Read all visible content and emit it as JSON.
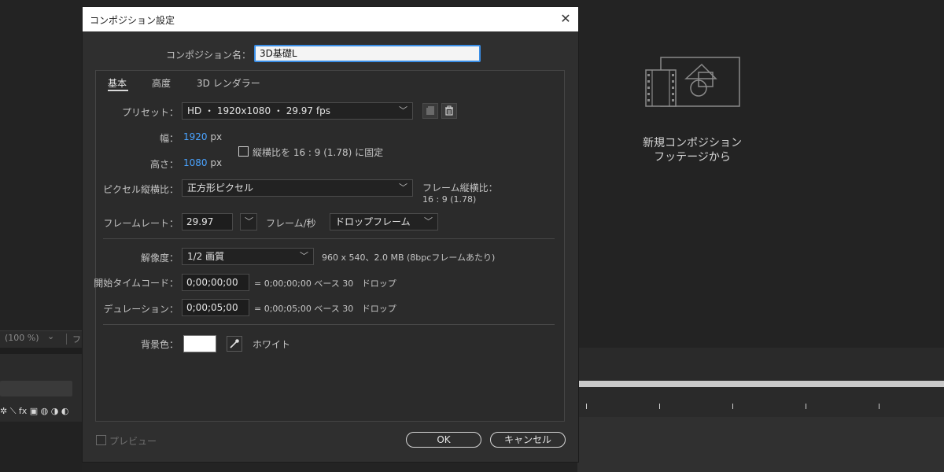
{
  "background": {
    "zoom_label": "(100 %)",
    "zoom_chevron": "⌄",
    "zoom_truncated": "フ",
    "tool_icons": "✲ ⟍ fx ▣ ◍ ◑ ◐",
    "new_comp_line1": "新規コンポジション",
    "new_comp_line2": "フッテージから"
  },
  "dialog": {
    "title": "コンポジション設定",
    "close_glyph": "✕",
    "comp_name_label": "コンポジション名：",
    "comp_name_value": "3D基礎L",
    "tabs": [
      {
        "label": "基本",
        "active": true
      },
      {
        "label": "高度",
        "active": false
      },
      {
        "label": "3D レンダラー",
        "active": false
      }
    ],
    "preset": {
      "label": "プリセット：",
      "value": "HD ・ 1920x1080 ・ 29.97 fps"
    },
    "width": {
      "label": "幅：",
      "value": "1920",
      "unit": "px"
    },
    "height": {
      "label": "高さ：",
      "value": "1080",
      "unit": "px"
    },
    "lock_aspect": {
      "label": "縦横比を 16 : 9 (1.78) に固定",
      "checked": false
    },
    "pixel_aspect": {
      "label": "ピクセル縦横比：",
      "value": "正方形ピクセル",
      "frame_aspect_label": "フレーム縦横比：",
      "frame_aspect_value": "16 : 9 (1.78)"
    },
    "frame_rate": {
      "label": "フレームレート：",
      "value": "29.97",
      "unit": "フレーム/秒",
      "drop_frame": "ドロップフレーム"
    },
    "resolution": {
      "label": "解像度：",
      "value": "1/2 画質",
      "info": "960 x 540、2.0 MB (8bpcフレームあたり)"
    },
    "start_timecode": {
      "label": "開始タイムコード：",
      "value": "0;00;00;00",
      "equals": "= 0;00;00;00",
      "base": "ベース 30",
      "drop": "ドロップ"
    },
    "duration": {
      "label": "デュレーション：",
      "value": "0;00;05;00",
      "equals": "= 0;00;05;00",
      "base": "ベース 30",
      "drop": "ドロップ"
    },
    "background_color": {
      "label": "背景色：",
      "name": "ホワイト",
      "hex": "#ffffff"
    },
    "preview": {
      "label": "プレビュー",
      "checked": false
    },
    "ok_label": "OK",
    "cancel_label": "キャンセル"
  },
  "colors": {
    "accent_blue": "#3a8ee6",
    "value_blue": "#4aa3ff",
    "dialog_bg": "#2f2f2f"
  }
}
